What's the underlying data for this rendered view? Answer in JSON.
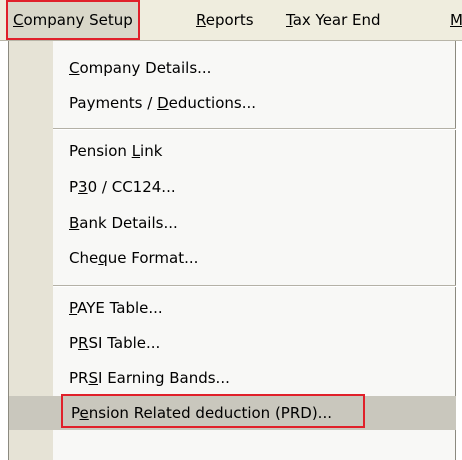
{
  "menubar": {
    "company_setup": {
      "pre": "",
      "key": "C",
      "post": "ompany Setup"
    },
    "reports": {
      "pre": "",
      "key": "R",
      "post": "eports"
    },
    "tax_year_end": {
      "pre": "",
      "key": "T",
      "post": "ax Year End"
    },
    "next_cut": "M"
  },
  "menu": {
    "company_details": {
      "pre": "",
      "key": "C",
      "post": "ompany Details..."
    },
    "payments_deductions": {
      "pre": "Payments / ",
      "key": "D",
      "post": "eductions..."
    },
    "pension_link": {
      "pre": "Pension ",
      "key": "L",
      "post": "ink"
    },
    "p30_cc124": {
      "pre": "P",
      "key": "3",
      "post": "0 / CC124..."
    },
    "bank_details": {
      "pre": "",
      "key": "B",
      "post": "ank Details..."
    },
    "cheque_format": {
      "pre": "Che",
      "key": "q",
      "post": "ue Format..."
    },
    "paye_table": {
      "pre": "",
      "key": "P",
      "post": "AYE Table..."
    },
    "prsi_table": {
      "pre": "P",
      "key": "R",
      "post": "SI Table..."
    },
    "prsi_earning_bands": {
      "pre": "PR",
      "key": "S",
      "post": "I Earning Bands..."
    },
    "pension_related_deduction": {
      "pre": "P",
      "key": "e",
      "post": "nsion Related deduction (PRD)..."
    }
  },
  "colors": {
    "highlight_box": "#e0202a",
    "menubar_bg": "#efedde",
    "gutter_bg": "#e6e3d6"
  }
}
